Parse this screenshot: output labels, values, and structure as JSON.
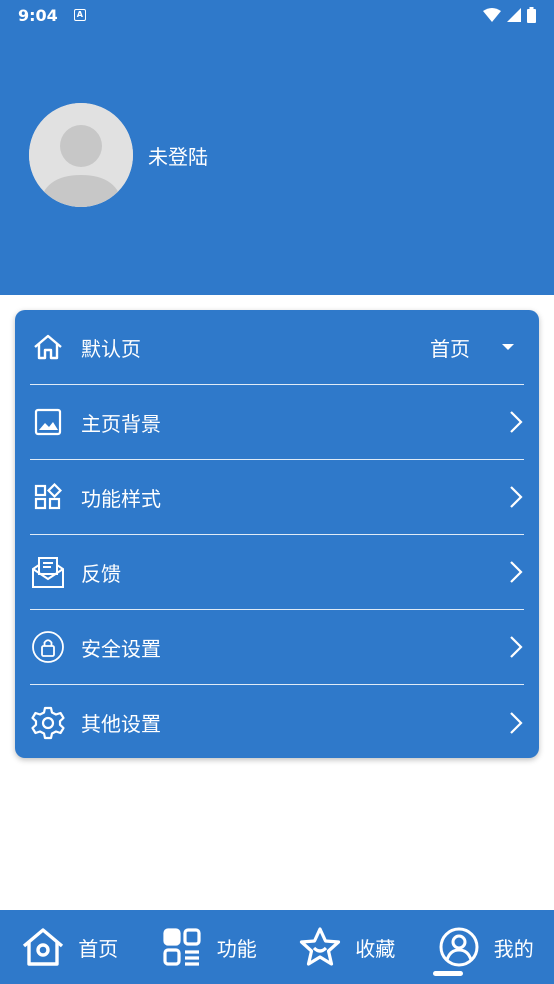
{
  "status_bar": {
    "time": "9:04",
    "badge": "A"
  },
  "profile": {
    "username": "未登陆"
  },
  "settings": [
    {
      "label": "默认页",
      "value": "首页"
    },
    {
      "label": "主页背景"
    },
    {
      "label": "功能样式"
    },
    {
      "label": "反馈"
    },
    {
      "label": "安全设置"
    },
    {
      "label": "其他设置"
    }
  ],
  "tabs": [
    {
      "label": "首页",
      "icon": "home-icon"
    },
    {
      "label": "功能",
      "icon": "grid-icon"
    },
    {
      "label": "收藏",
      "icon": "star-icon"
    },
    {
      "label": "我的",
      "icon": "person-icon",
      "active": true
    }
  ],
  "colors": {
    "primary": "#2f79ca",
    "avatar_bg": "#e1e1e1",
    "text": "#ffffff"
  }
}
